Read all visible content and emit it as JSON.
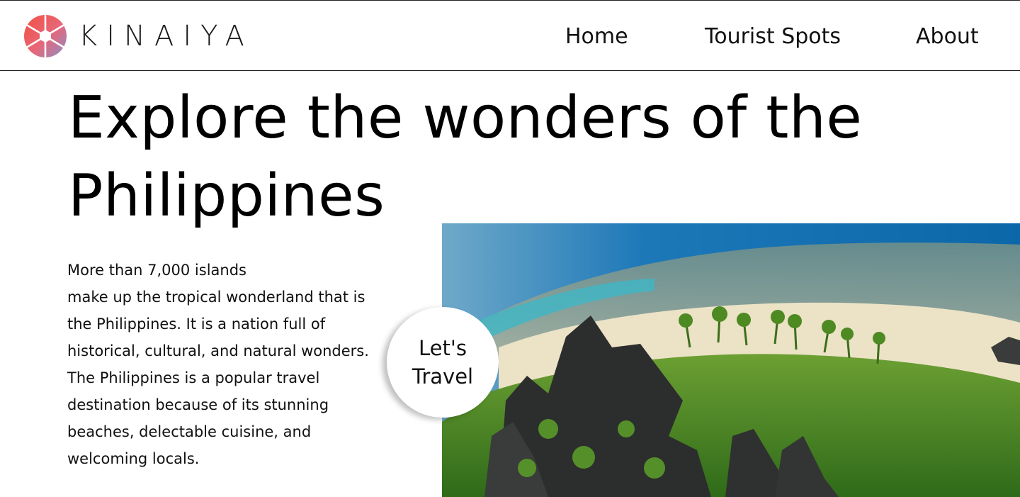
{
  "brand": {
    "name": "KINAIYA",
    "logo_icon": "aperture-icon"
  },
  "nav": {
    "items": [
      {
        "label": "Home"
      },
      {
        "label": "Tourist Spots"
      },
      {
        "label": "About"
      }
    ]
  },
  "hero": {
    "title": "Explore the wonders of the Philippines",
    "intro_first_line": "More than 7,000 islands",
    "intro_rest": "make up the tropical wonderland that is the Philippines. It is a nation full of historical, cultural, and natural wonders. The Philippines is a popular travel destination because of its stunning beaches, delectable cuisine, and welcoming locals.",
    "cta_label": "Let's Travel",
    "image_subject": "aerial-island-photo"
  },
  "colors": {
    "logo_red": "#f25a4f",
    "logo_purple": "#8a8fc9",
    "sea_blue": "#0f6aa8",
    "lagoon_turquoise": "#3fb7c6",
    "sand": "#efe6cf",
    "jungle_green": "#4e8a25",
    "rock_dark": "#2c2d2d"
  }
}
